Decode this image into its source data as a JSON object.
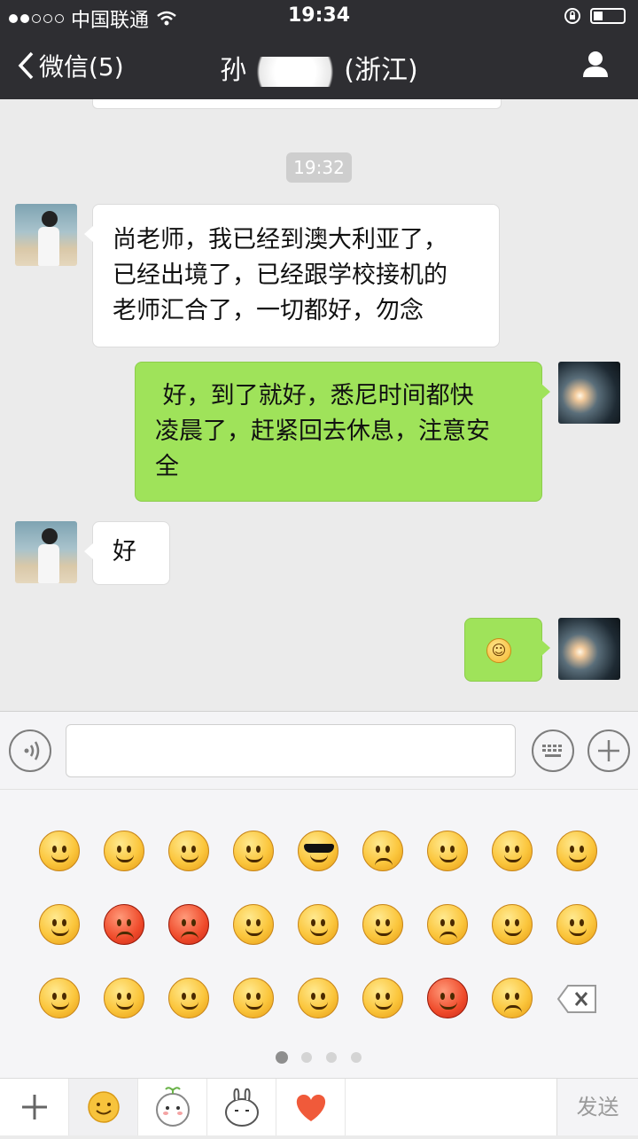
{
  "status_bar": {
    "carrier": "中国联通",
    "time": "19:34",
    "battery_percent": 30
  },
  "nav": {
    "back_label": "微信(5)",
    "title_prefix": "孙",
    "title_suffix": "(浙江)"
  },
  "chat": {
    "timestamp": "19:32",
    "messages": [
      {
        "from": "friend",
        "lines": [
          "尚老师，我已经到澳大利亚了，",
          "已经出境了，已经跟学校接机的",
          "老师汇合了，一切都好，勿念"
        ]
      },
      {
        "from": "me",
        "lines": [
          " 好，到了就好，悉尼时间都快",
          "凌晨了，赶紧回去休息，注意安",
          "全"
        ]
      },
      {
        "from": "friend",
        "lines": [
          "好"
        ]
      },
      {
        "from": "me",
        "emoji": "smile-emoji"
      }
    ]
  },
  "input": {
    "placeholder": ""
  },
  "emoji_panel": {
    "rows": [
      [
        "smile",
        "awkward",
        "heart-eyes",
        "glare",
        "cool",
        "cry",
        "shy",
        "shut-up",
        "sleep"
      ],
      [
        "tears-of-joy",
        "angry-red",
        "furious",
        "tongue",
        "grin",
        "surprised",
        "frown",
        "blush",
        "scream"
      ],
      [
        "nauseous",
        "yawn",
        "smile-blush",
        "confused",
        "doubt",
        "speechless",
        "frightened",
        "tears",
        "delete"
      ]
    ],
    "pages": 4,
    "current_page": 1
  },
  "toolbar": {
    "send_label": "发送"
  }
}
